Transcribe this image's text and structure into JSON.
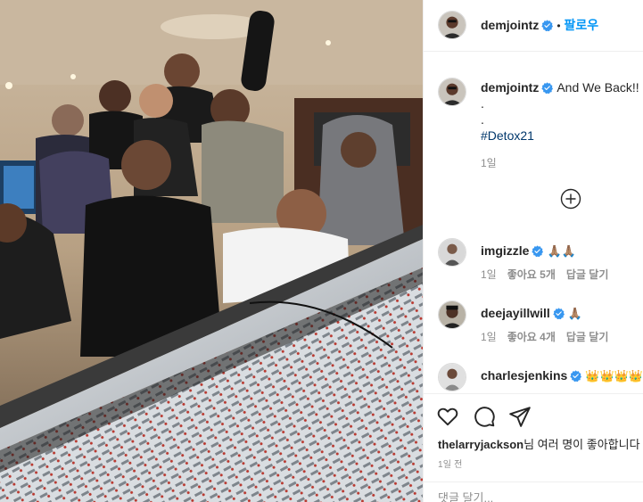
{
  "post": {
    "author": "demjointz",
    "follow_label": "팔로우",
    "separator": "•"
  },
  "caption": {
    "username": "demjointz",
    "text": "And We Back!!",
    "lines": [
      ".",
      "."
    ],
    "hashtag": "#Detox21",
    "time": "1일"
  },
  "comments": [
    {
      "username": "imgizzle",
      "emoji": "🙏🏽🙏🏽",
      "time": "1일",
      "likes": "좋아요 5개",
      "reply": "답글 달기"
    },
    {
      "username": "deejayillwill",
      "emoji": "🙏🏽",
      "time": "1일",
      "likes": "좋아요 4개",
      "reply": "답글 달기"
    },
    {
      "username": "charlesjenkins",
      "emoji": "👑👑👑👑",
      "time": "",
      "likes": "",
      "reply": ""
    }
  ],
  "footer": {
    "liked_by_user": "thelarryjackson",
    "liked_by_rest": "님 여러 명이 좋아합니다",
    "time": "1일 전",
    "comment_placeholder": "댓글 달기..."
  },
  "icons": {
    "verified": "verified-badge-icon",
    "load_more": "plus-circle-icon",
    "like": "heart-icon",
    "comment": "comment-bubble-icon",
    "share": "paper-plane-icon"
  },
  "colors": {
    "accent": "#0095f6",
    "verified": "#3897f0",
    "hashtag": "#00376b",
    "muted": "#8e8e8e",
    "text": "#262626"
  }
}
